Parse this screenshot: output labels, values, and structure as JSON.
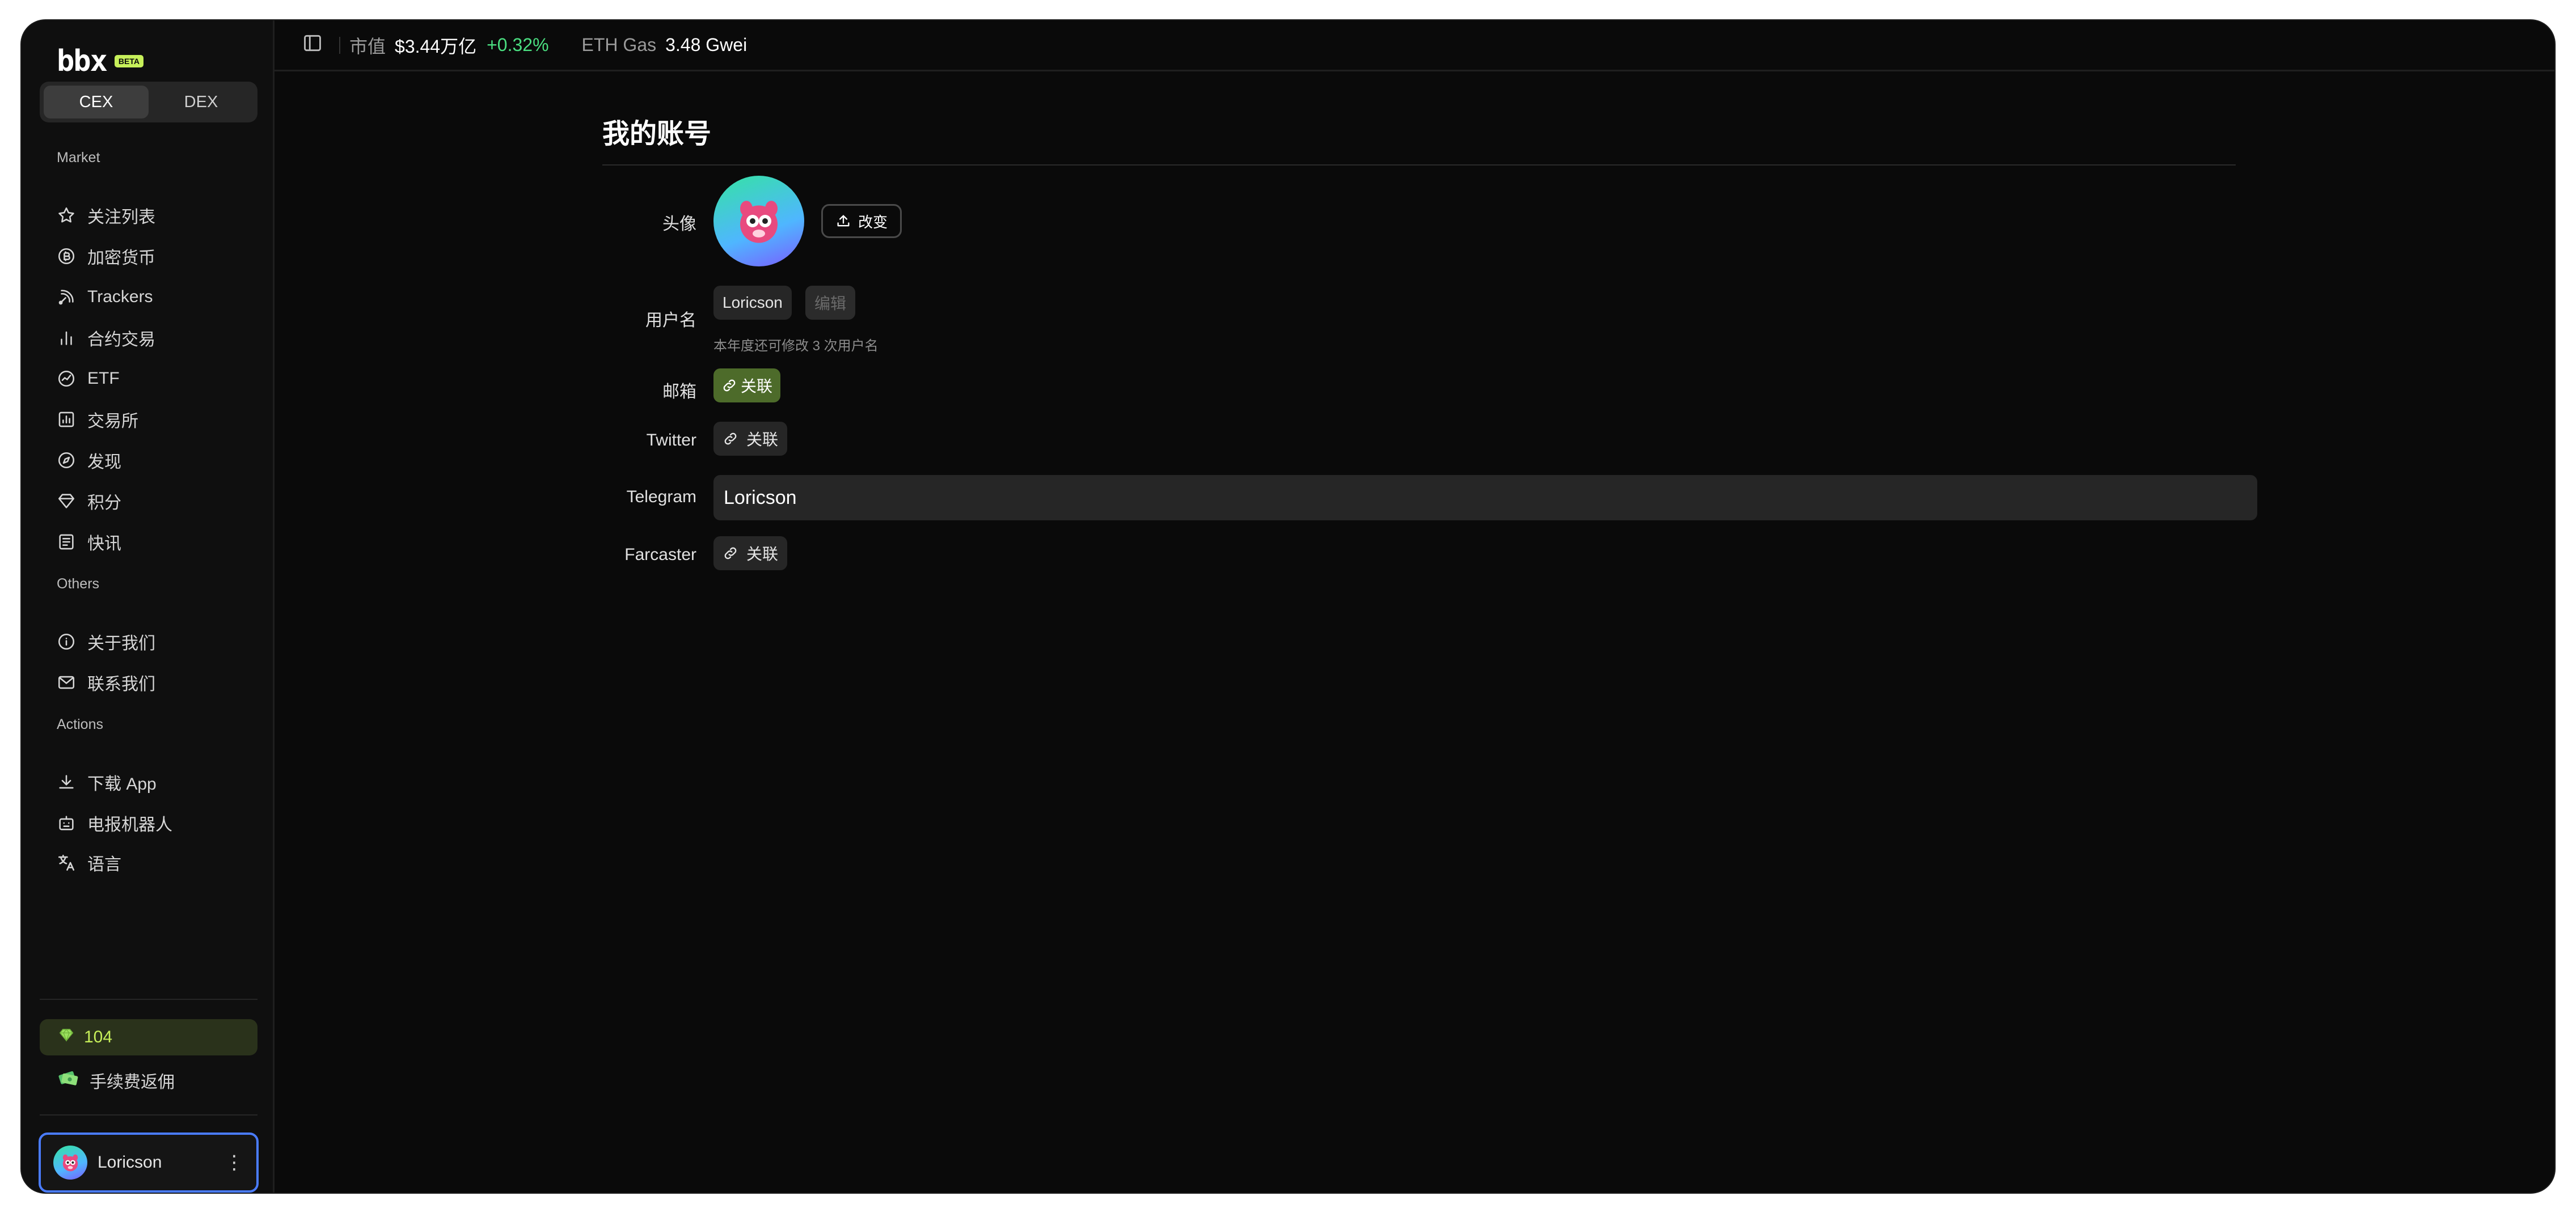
{
  "app": {
    "logo_text": "bbx",
    "badge": "BETA"
  },
  "mode_switch": {
    "options": [
      "CEX",
      "DEX"
    ],
    "selected": "CEX"
  },
  "sidebar": {
    "sections": [
      {
        "title": "Market",
        "items": [
          {
            "label": "关注列表",
            "icon": "star-icon"
          },
          {
            "label": "加密货币",
            "icon": "coin-icon"
          },
          {
            "label": "Trackers",
            "icon": "radar-icon"
          },
          {
            "label": "合约交易",
            "icon": "bar-chart-icon"
          },
          {
            "label": "ETF",
            "icon": "check-circle-icon"
          },
          {
            "label": "交易所",
            "icon": "exchange-chart-icon"
          },
          {
            "label": "发现",
            "icon": "compass-icon"
          },
          {
            "label": "积分",
            "icon": "diamond-icon"
          },
          {
            "label": "快讯",
            "icon": "newspaper-icon"
          }
        ]
      },
      {
        "title": "Others",
        "items": [
          {
            "label": "关于我们",
            "icon": "info-icon"
          },
          {
            "label": "联系我们",
            "icon": "mail-icon"
          }
        ]
      },
      {
        "title": "Actions",
        "items": [
          {
            "label": "下载 App",
            "icon": "download-icon"
          },
          {
            "label": "电报机器人",
            "icon": "bot-icon"
          },
          {
            "label": "语言",
            "icon": "translate-icon"
          }
        ]
      }
    ],
    "points": "104",
    "rebate_label": "手续费返佣",
    "user_name": "Loricson"
  },
  "topbar": {
    "market_cap_label": "市值",
    "market_cap_value": "$3.44万亿",
    "market_cap_change": "+0.32%",
    "gas_label": "ETH Gas",
    "gas_value": "3.48 Gwei"
  },
  "account": {
    "title": "我的账号",
    "avatar_label": "头像",
    "change_button": "改变",
    "username_label": "用户名",
    "username_value": "Loricson",
    "edit_button": "编辑",
    "username_hint": "本年度还可修改 3 次用户名",
    "email_label": "邮箱",
    "email_link_button": "关联",
    "twitter_label": "Twitter",
    "twitter_link_button": "关联",
    "telegram_label": "Telegram",
    "telegram_value": "Loricson",
    "farcaster_label": "Farcaster",
    "farcaster_link_button": "关联"
  },
  "colors": {
    "accent_green": "#4ade80",
    "lime": "#c7f05a",
    "focus_blue": "#4a7cff"
  }
}
